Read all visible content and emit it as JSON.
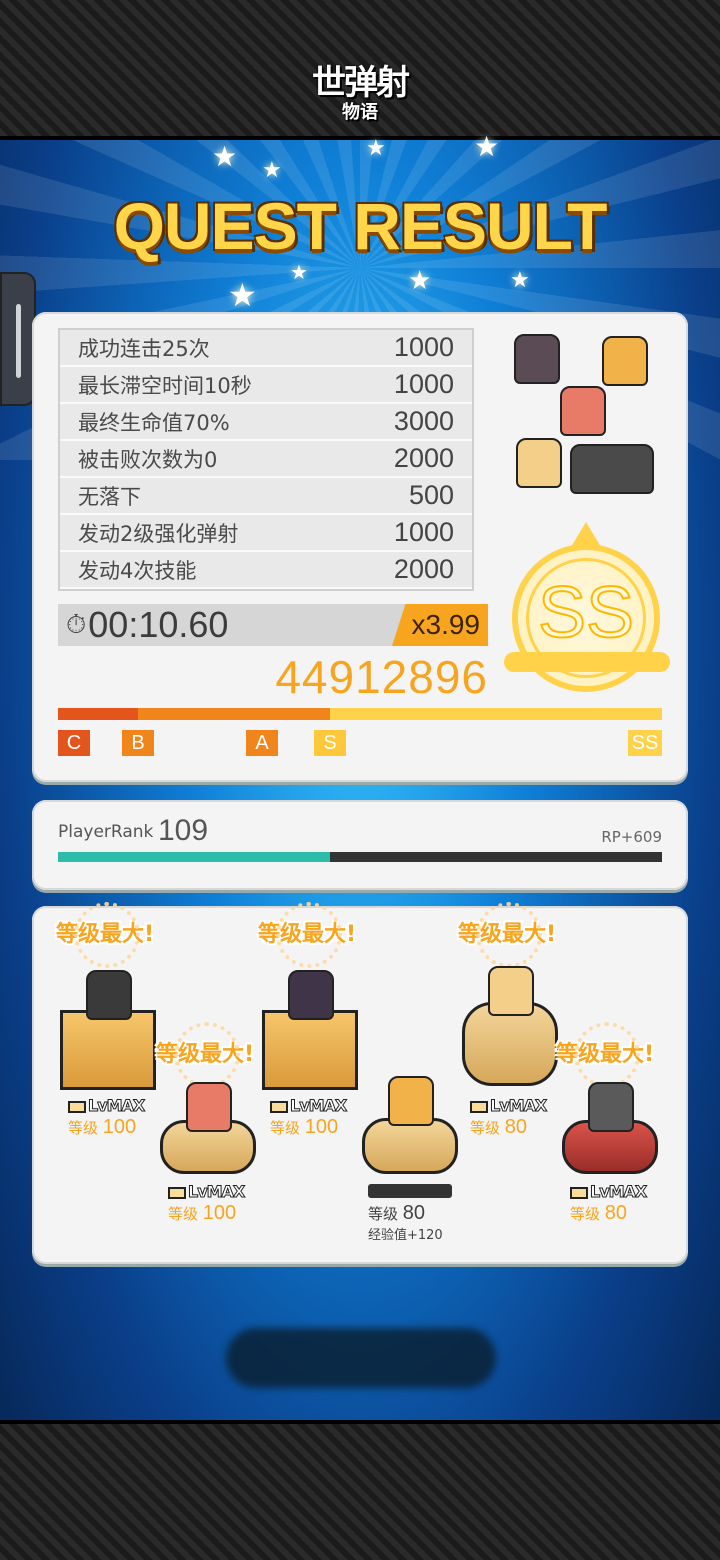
{
  "app": {
    "logo_main": "世弹射",
    "logo_sub": "物语"
  },
  "title": "QUEST RESULT",
  "bonuses": [
    {
      "label": "成功连击25次",
      "points": "1000"
    },
    {
      "label": "最长滞空时间10秒",
      "points": "1000"
    },
    {
      "label": "最终生命值70%",
      "points": "3000"
    },
    {
      "label": "被击败次数为0",
      "points": "2000"
    },
    {
      "label": "无落下",
      "points": "500"
    },
    {
      "label": "发动2级强化弹射",
      "points": "1000"
    },
    {
      "label": "发动4次技能",
      "points": "2000"
    }
  ],
  "timer": {
    "time": "00:10.60",
    "multiplier": "x3.99"
  },
  "score": "44912896",
  "grade": "SS",
  "grade_marks": {
    "c": "C",
    "b": "B",
    "a": "A",
    "s": "S",
    "ss": "SS"
  },
  "player_rank": {
    "label": "PlayerRank",
    "value": "109",
    "rp": "RP+609",
    "progress": 0.45
  },
  "characters": [
    {
      "max_badge": "等级最大!",
      "lv_tag": "LvMAX",
      "level_label": "等级",
      "level": "100"
    },
    {
      "max_badge": "等级最大!",
      "lv_tag": "LvMAX",
      "level_label": "等级",
      "level": "100"
    },
    {
      "max_badge": "等级最大!",
      "lv_tag": "LvMAX",
      "level_label": "等级",
      "level": "100"
    },
    {
      "level_label": "等级",
      "level": "80",
      "exp": "经验值+120"
    },
    {
      "max_badge": "等级最大!",
      "lv_tag": "LvMAX",
      "level_label": "等级",
      "level": "80"
    },
    {
      "max_badge": "等级最大!",
      "lv_tag": "LvMAX",
      "level_label": "等级",
      "level": "80"
    }
  ],
  "colors": {
    "accent": "#f7a51f",
    "gold": "#ffd24a",
    "rank_bar": "#2bbdaa",
    "grade_c": "#e4551e"
  }
}
